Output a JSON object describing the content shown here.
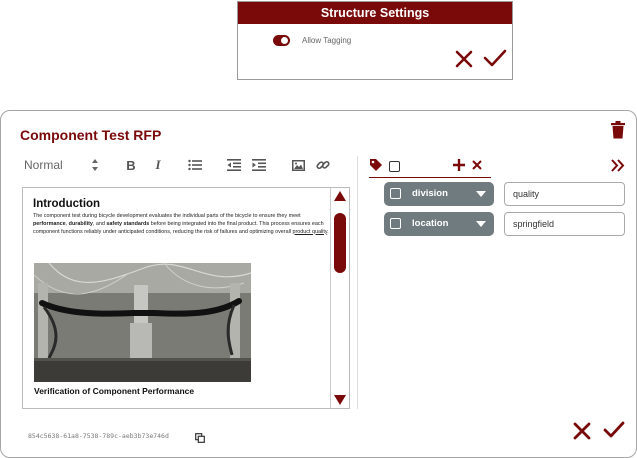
{
  "structure_settings": {
    "title": "Structure Settings",
    "allow_tagging_label": "Allow Tagging",
    "allow_tagging_on": true
  },
  "card": {
    "title": "Component Test RFP",
    "hash": "854c5638-61a8-7538-789c-aeb3b73e746d"
  },
  "toolbar": {
    "format_value": "Normal",
    "bold_label": "B",
    "italic_label": "I"
  },
  "editor": {
    "heading": "Introduction",
    "p_part1": "The component test during bicycle development evaluates the individual parts of the bicycle to ensure they meet ",
    "p_b1": "performance",
    "p_part2": ", ",
    "p_b2": "durability",
    "p_part3": ", and ",
    "p_b3": "safety standards",
    "p_part4": " before being integrated into the final product. This process ensures each component functions reliably under anticipated conditions, reducing the risk of failures and optimizing overall ",
    "p_link": "product quality",
    "p_end": ".",
    "subheading": "Verification of Component Performance"
  },
  "tags": [
    {
      "name": "division",
      "value": "quality"
    },
    {
      "name": "location",
      "value": "springfield"
    }
  ],
  "colors": {
    "accent": "#7a0a0a",
    "tag_bg": "#6f7b7e"
  }
}
